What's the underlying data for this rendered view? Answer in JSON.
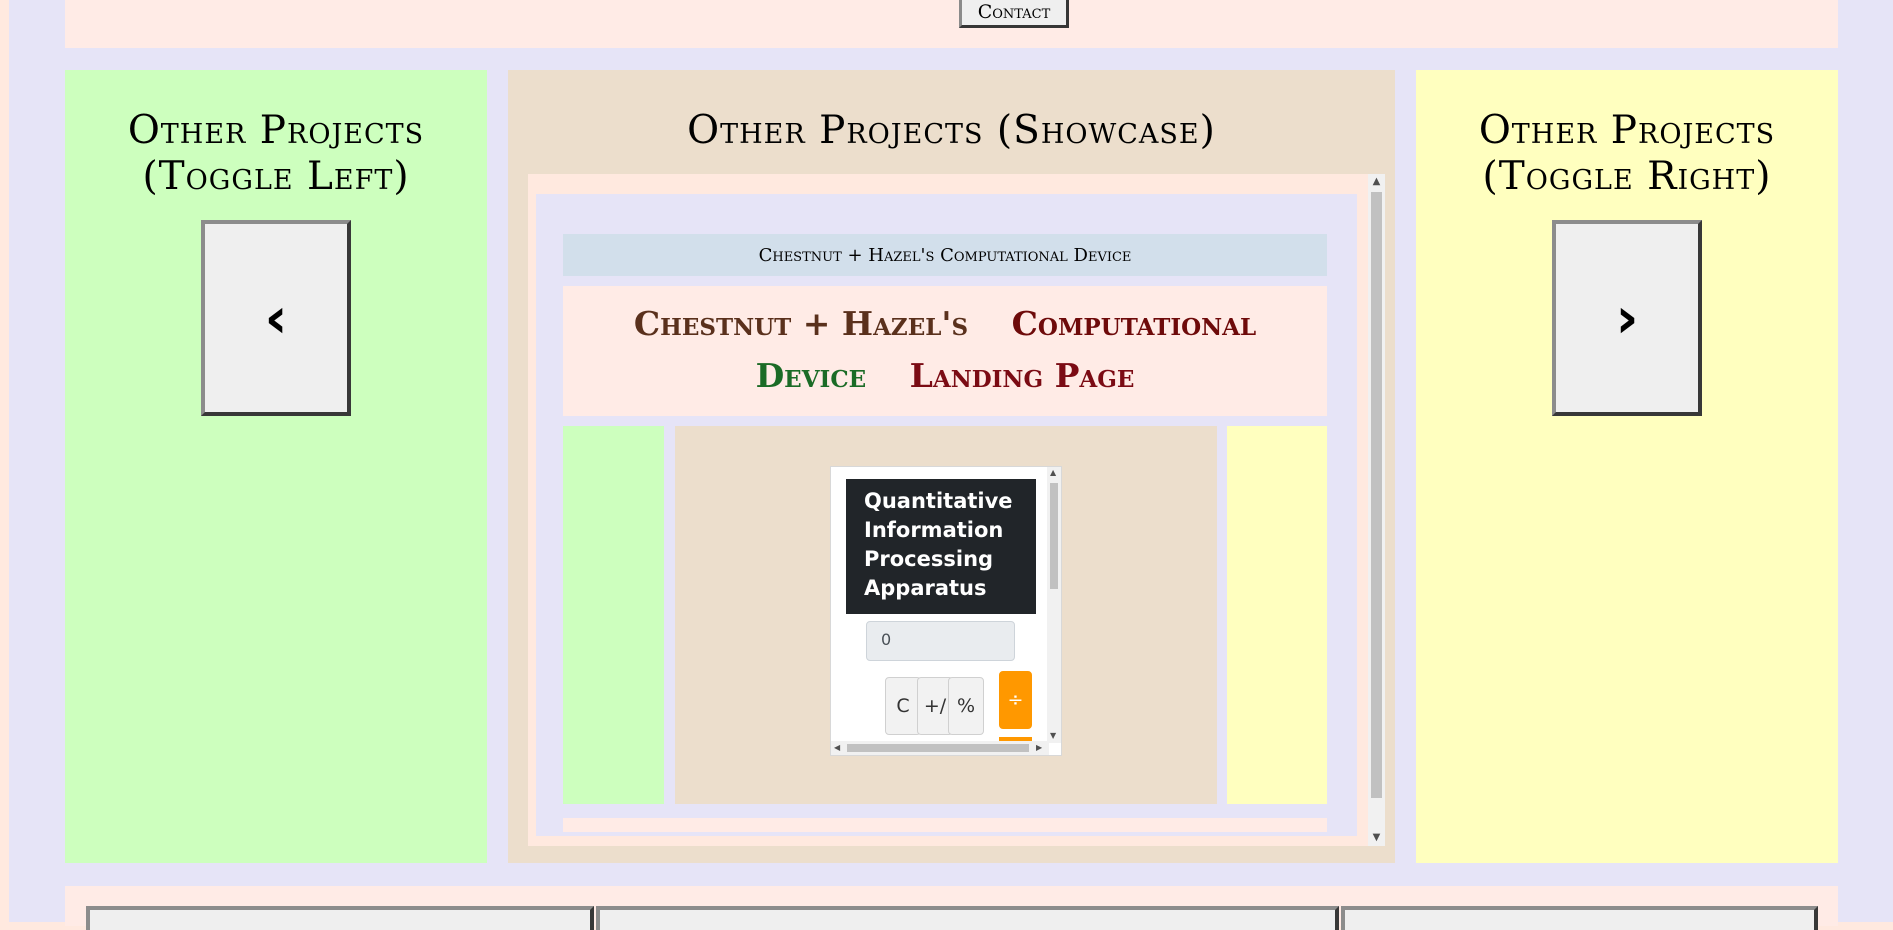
{
  "header": {
    "contact_label": "Contact"
  },
  "left_panel": {
    "title": "Other Projects (Toggle Left)",
    "button_glyph": "‹",
    "button_icon": "chevron-left-icon"
  },
  "center_panel": {
    "title": "Other Projects (Showcase)",
    "showcase": {
      "page_title": "Chestnut + Hazel's Computational Device",
      "heading_words": [
        "Chestnut + Hazel's",
        "Computational",
        "Device",
        "Landing Page"
      ],
      "heading_colors": [
        "#5a301c",
        "#6e0a0a",
        "#1b6b26",
        "#7b0b14"
      ],
      "calculator": {
        "title": "Quantitative Information Processing Apparatus",
        "display_value": "0",
        "buttons": [
          "C",
          "+/",
          "%",
          "÷"
        ],
        "accent_color": "#ff9800"
      }
    }
  },
  "right_panel": {
    "title": "Other Projects (Toggle Right)",
    "button_glyph": "›",
    "button_icon": "chevron-right-icon"
  },
  "colors": {
    "page_background": "#e6e4f7",
    "left_panel": "#cdffbe",
    "center_panel": "#ecdecc",
    "right_panel": "#ffffbf",
    "title_bar": "#d2dfeb"
  }
}
